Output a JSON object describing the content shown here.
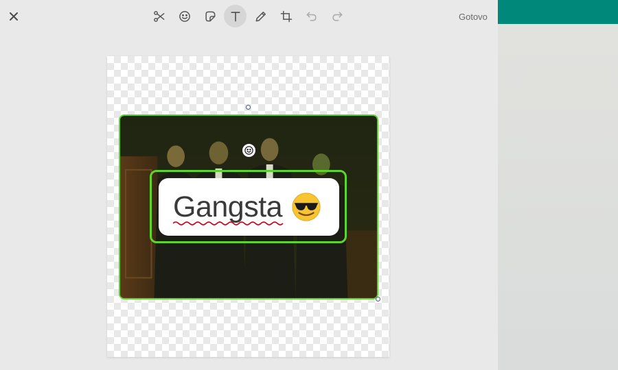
{
  "header": {
    "done_label": "Gotovo"
  },
  "toolbar": {
    "tools": [
      {
        "name": "scissors",
        "icon": "scissors-icon"
      },
      {
        "name": "emoji",
        "icon": "smiley-icon"
      },
      {
        "name": "sticker",
        "icon": "sticker-icon"
      },
      {
        "name": "text",
        "icon": "text-icon",
        "active": true
      },
      {
        "name": "draw",
        "icon": "pencil-icon"
      },
      {
        "name": "crop",
        "icon": "crop-icon"
      },
      {
        "name": "undo",
        "icon": "undo-icon"
      },
      {
        "name": "redo",
        "icon": "redo-icon"
      }
    ]
  },
  "overlay": {
    "text": "Gangsta",
    "emoji": "sunglasses-emoji"
  },
  "colors": {
    "selection": "#5ed42d",
    "accent": "#00897b",
    "spellcheck": "#d0021b"
  }
}
